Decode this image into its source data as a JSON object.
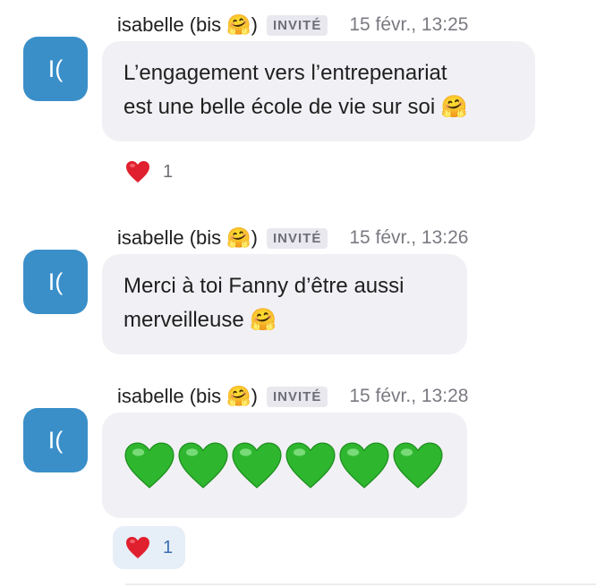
{
  "messages": [
    {
      "author": "isabelle (bis 🤗)",
      "badge": "INVITÉ",
      "time": "15 févr., 13:25",
      "avatar_initials": "I(",
      "lines": [
        "L’engagement vers l’entrepenariat",
        "est une belle école de vie sur soi 🤗"
      ],
      "reaction": {
        "emoji": "❤️",
        "count": "1"
      }
    },
    {
      "author": "isabelle (bis 🤗)",
      "badge": "INVITÉ",
      "time": "15 févr., 13:26",
      "avatar_initials": "I(",
      "lines": [
        "Merci à toi Fanny d’être aussi",
        "merveilleuse 🤗"
      ]
    },
    {
      "author": "isabelle (bis 🤗)",
      "badge": "INVITÉ",
      "time": "15 févr., 13:28",
      "avatar_initials": "I(",
      "green_hearts": 6,
      "reaction": {
        "emoji": "❤️",
        "count": "1"
      }
    }
  ],
  "colors": {
    "avatar": "#3a8fc9",
    "bubble": "#f1f1f5",
    "badge_bg": "#e8e8ee",
    "heart_red": "#e0202e",
    "heart_green": "#2fb62f",
    "reaction_active_bg": "#e6eef8"
  },
  "icons": {
    "reaction": "red-heart-icon",
    "content": "green-heart-icon"
  }
}
